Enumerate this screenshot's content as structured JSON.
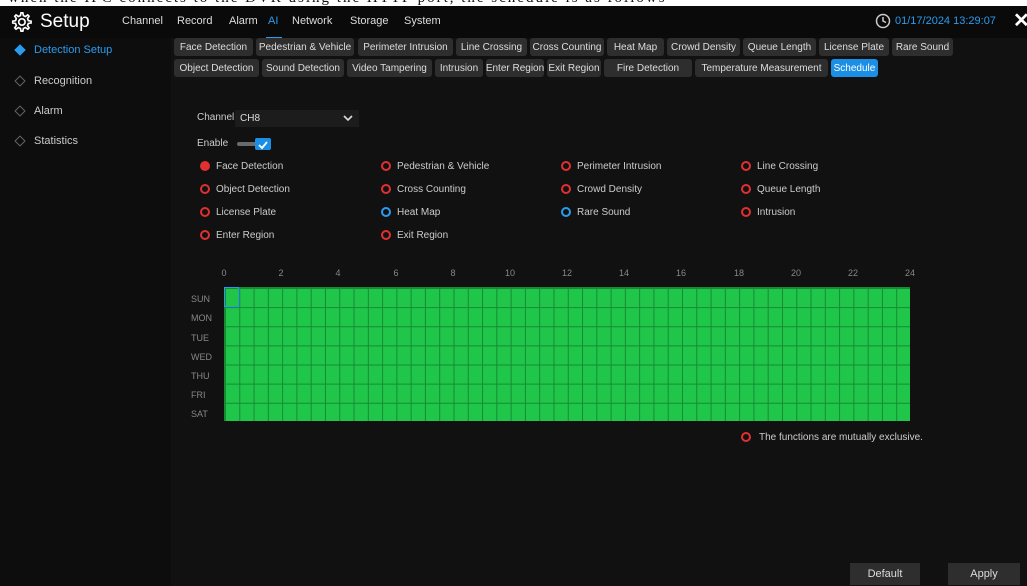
{
  "header": {
    "title": "Setup",
    "tabs": [
      {
        "label": "Channel"
      },
      {
        "label": "Record"
      },
      {
        "label": "Alarm"
      },
      {
        "label": "AI"
      },
      {
        "label": "Network"
      },
      {
        "label": "Storage"
      },
      {
        "label": "System"
      }
    ],
    "active_tab": "AI",
    "datetime": "01/17/2024 13:29:07",
    "close_label": "✕"
  },
  "sidebar": {
    "items": [
      {
        "label": "Detection Setup"
      },
      {
        "label": "Recognition"
      },
      {
        "label": "Alarm"
      },
      {
        "label": "Statistics"
      }
    ],
    "active": "Detection Setup"
  },
  "subtabs": {
    "row1": [
      "Face Detection",
      "Pedestrian & Vehicle",
      "Perimeter Intrusion",
      "Line Crossing",
      "Cross Counting",
      "Heat Map",
      "Crowd Density",
      "Queue Length",
      "License Plate",
      "Rare Sound"
    ],
    "row2": [
      "Object Detection",
      "Sound Detection",
      "Video Tampering",
      "Intrusion",
      "Enter Region",
      "Exit Region",
      "Fire Detection",
      "Temperature Measurement",
      "Schedule"
    ],
    "active": "Schedule"
  },
  "form": {
    "channel_label": "Channel",
    "channel_value": "CH8",
    "enable_label": "Enable",
    "enabled": true
  },
  "functions": [
    {
      "label": "Face Detection",
      "state": "selected"
    },
    {
      "label": "Pedestrian & Vehicle",
      "state": "exclusive"
    },
    {
      "label": "Perimeter Intrusion",
      "state": "exclusive"
    },
    {
      "label": "Line Crossing",
      "state": "exclusive"
    },
    {
      "label": "Object Detection",
      "state": "exclusive"
    },
    {
      "label": "Cross Counting",
      "state": "exclusive"
    },
    {
      "label": "Crowd Density",
      "state": "exclusive"
    },
    {
      "label": "Queue Length",
      "state": "exclusive"
    },
    {
      "label": "License Plate",
      "state": "exclusive"
    },
    {
      "label": "Heat Map",
      "state": "available"
    },
    {
      "label": "Rare Sound",
      "state": "available"
    },
    {
      "label": "Intrusion",
      "state": "exclusive"
    },
    {
      "label": "Enter Region",
      "state": "exclusive"
    },
    {
      "label": "Exit Region",
      "state": "exclusive"
    }
  ],
  "schedule": {
    "hours": [
      "0",
      "2",
      "4",
      "6",
      "8",
      "10",
      "12",
      "14",
      "16",
      "18",
      "20",
      "22",
      "24"
    ],
    "days": [
      "SUN",
      "MON",
      "TUE",
      "WED",
      "THU",
      "FRI",
      "SAT"
    ],
    "all_enabled": true,
    "color_enabled": "#1fc64a"
  },
  "note": "The functions are mutually exclusive.",
  "buttons": {
    "default": "Default",
    "apply": "Apply"
  },
  "colors": {
    "accent": "#1b8ee6",
    "exclusive": "#e03030",
    "available": "#2b9bf0"
  }
}
